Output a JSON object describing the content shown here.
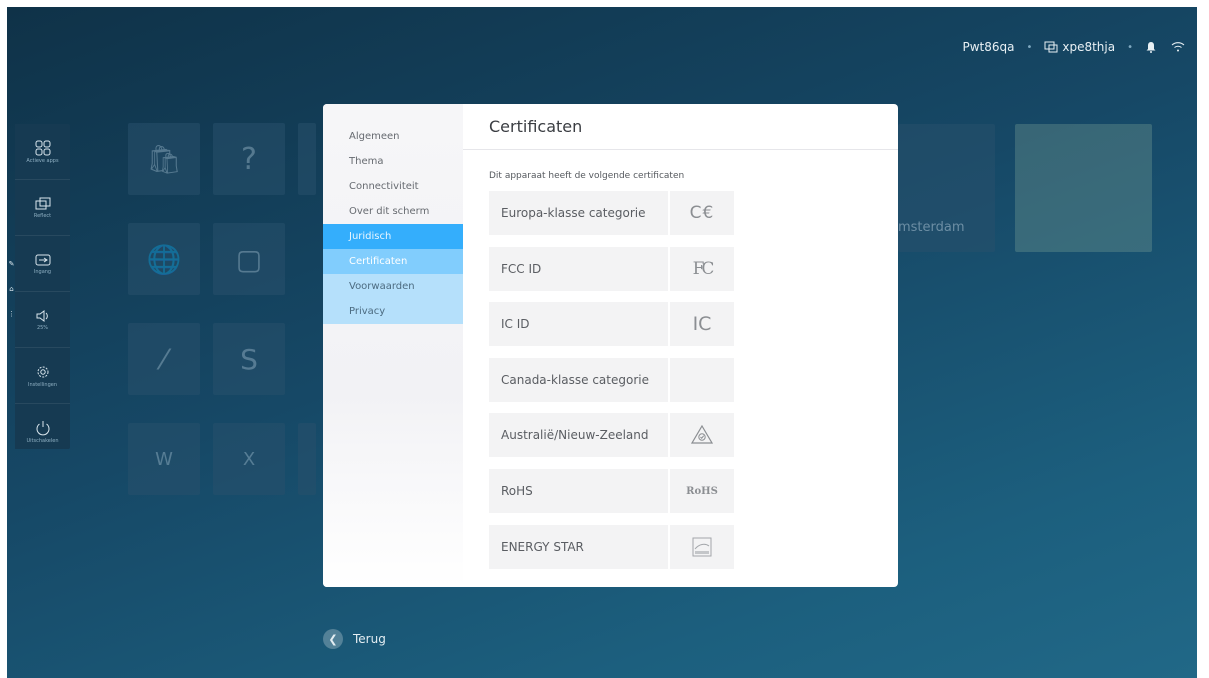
{
  "status_bar": {
    "device_name": "Pwt86qa",
    "display_name": "xpe8thja",
    "icons": [
      "display-icon",
      "bell-icon",
      "wifi-icon"
    ]
  },
  "sidebar": {
    "items": [
      {
        "icon": "apps-grid-icon",
        "label": "Actieve apps"
      },
      {
        "icon": "reflect-icon",
        "label": "Reflect"
      },
      {
        "icon": "input-icon",
        "label": "Ingang"
      },
      {
        "icon": "volume-icon",
        "label": "25%"
      },
      {
        "icon": "settings-gear-icon",
        "label": "Instellingen"
      },
      {
        "icon": "power-icon",
        "label": "Uitschakelen"
      }
    ]
  },
  "background": {
    "tile_text": "msterdam"
  },
  "settings": {
    "nav": [
      {
        "label": "Algemeen"
      },
      {
        "label": "Thema"
      },
      {
        "label": "Connectiviteit"
      },
      {
        "label": "Over dit scherm"
      },
      {
        "label": "Juridisch"
      },
      {
        "label": "Certificaten"
      },
      {
        "label": "Voorwaarden"
      },
      {
        "label": "Privacy"
      }
    ],
    "title": "Certificaten",
    "subtitle": "Dit apparaat heeft de volgende certificaten",
    "certificates": [
      {
        "label": "Europa-klasse categorie",
        "logo_text": "C€",
        "logo_icon": "ce-mark-icon"
      },
      {
        "label": "FCC ID",
        "logo_text": "FC",
        "logo_icon": "fcc-logo-icon"
      },
      {
        "label": "IC ID",
        "logo_text": "IC",
        "logo_icon": "ic-logo-icon"
      },
      {
        "label": "Canada-klasse categorie",
        "logo_text": "",
        "logo_icon": ""
      },
      {
        "label": "Australië/Nieuw-Zeeland",
        "logo_text": "",
        "logo_icon": "rcm-mark-icon"
      },
      {
        "label": "RoHS",
        "logo_text": "RoHS",
        "logo_icon": "rohs-logo-icon"
      },
      {
        "label": "ENERGY STAR",
        "logo_text": "",
        "logo_icon": "energy-star-logo-icon"
      }
    ]
  },
  "back": {
    "label": "Terug"
  },
  "colors": {
    "background": "#164866",
    "nav_active": "#34aefc",
    "nav_sub_active": "#81cdfd",
    "nav_sub": "#b5e0fb",
    "cert_row_bg": "#f3f3f4"
  }
}
